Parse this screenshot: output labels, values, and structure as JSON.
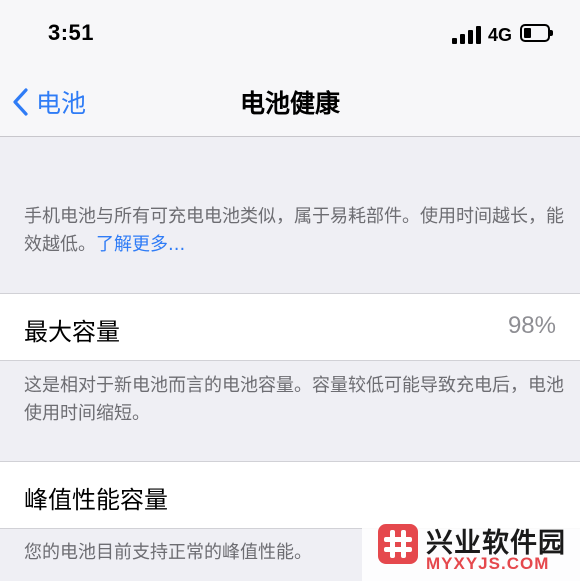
{
  "status_bar": {
    "time": "3:51",
    "network": "4G",
    "battery_level_fraction": 0.3
  },
  "nav": {
    "back_label": "电池",
    "title": "电池健康"
  },
  "info": {
    "description": "手机电池与所有可充电电池类似，属于易耗部件。使用时间越长，能效越低。",
    "learn_more": "了解更多..."
  },
  "max_capacity": {
    "label": "最大容量",
    "value": "98%",
    "footer": "这是相对于新电池而言的电池容量。容量较低可能导致充电后，电池使用时间缩短。"
  },
  "peak_performance": {
    "label": "峰值性能容量",
    "footer": "您的电池目前支持正常的峰值性能。"
  },
  "watermark": {
    "title": "兴业软件园",
    "subtitle": "MYXYJS.COM"
  },
  "colors": {
    "accent": "#2f7cf6",
    "background": "#efeff4",
    "secondary_text": "#6d6d72",
    "value_text": "#8e8e93",
    "watermark_red": "#e5484d"
  }
}
